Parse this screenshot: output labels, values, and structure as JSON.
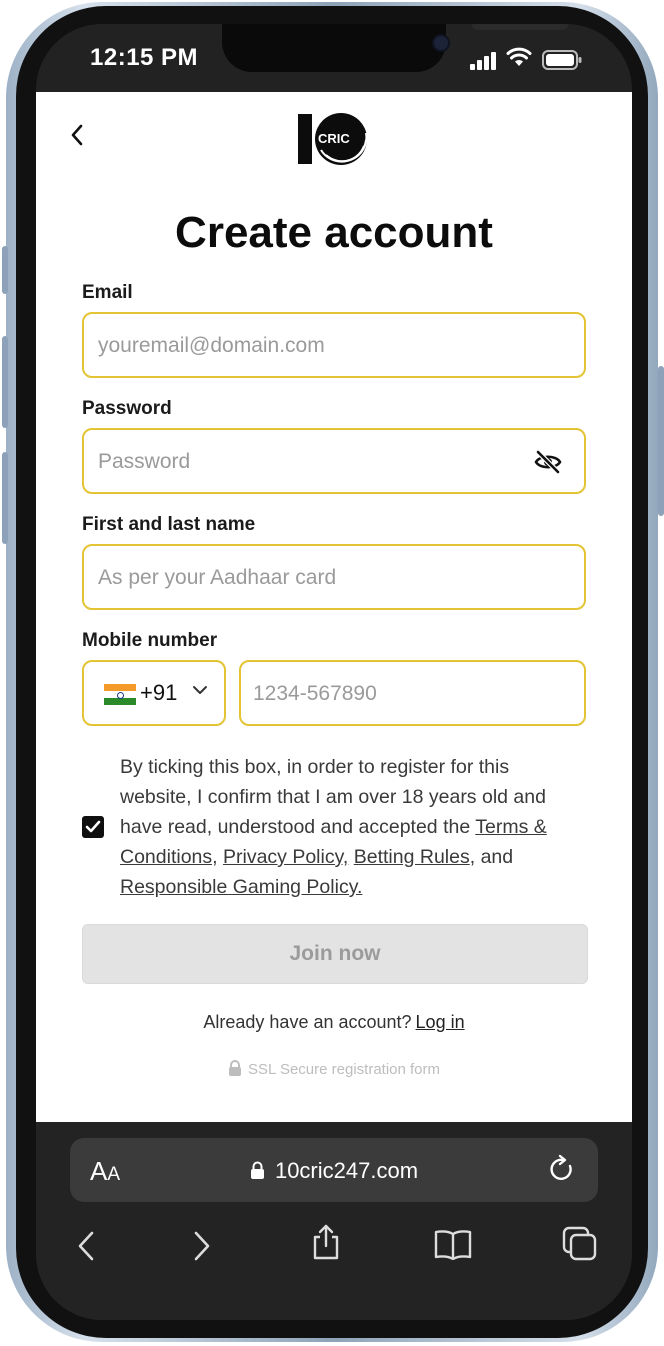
{
  "status_bar": {
    "time": "12:15 PM"
  },
  "logo": {
    "text": "CRIC"
  },
  "page": {
    "title": "Create account"
  },
  "form": {
    "email": {
      "label": "Email",
      "placeholder": "youremail@domain.com",
      "value": ""
    },
    "password": {
      "label": "Password",
      "placeholder": "Password",
      "value": ""
    },
    "name": {
      "label": "First and last name",
      "placeholder": "As per your Aadhaar card",
      "value": ""
    },
    "mobile": {
      "label": "Mobile number",
      "country_code": "+91",
      "placeholder": "1234-567890",
      "value": ""
    },
    "consent": {
      "checked": true,
      "text_before": "By ticking this box, in order to register for this website, I confirm that I am over 18 years old and have read, understood and accepted the ",
      "link_terms": "Terms & Conditions,",
      "link_privacy": "Privacy Policy,",
      "link_betting": "Betting Rules",
      "text_and": ", and ",
      "link_responsible": "Responsible Gaming Policy."
    },
    "submit_label": "Join now"
  },
  "login_prompt": {
    "text": "Already have an account?",
    "link": "Log in"
  },
  "ssl_note": "SSL Secure registration form",
  "browser": {
    "aa_label": "A",
    "aa_small": "A",
    "url": "10cric247.com"
  },
  "colors": {
    "field_border": "#e4c435",
    "button_disabled": "#e3e3e3"
  }
}
